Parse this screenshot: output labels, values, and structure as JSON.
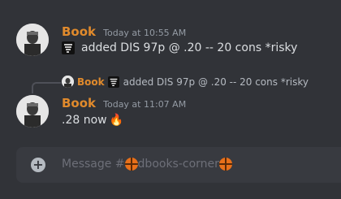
{
  "messages": [
    {
      "author": "Book",
      "timestamp": "Today at 10:55 AM",
      "content": "added DIS 97p @ .20 -- 20 cons  *risky",
      "icon": "tornado-icon"
    },
    {
      "reply_to": {
        "author": "Book",
        "content": "added DIS 97p @ .20 -- 20 cons *risky"
      },
      "author": "Book",
      "timestamp": "Today at 11:07 AM",
      "content": ".28 now",
      "emoji": "🔥"
    }
  ],
  "composer": {
    "placeholder_prefix": "Message #",
    "placeholder_channel": "dbooks-corner"
  },
  "colors": {
    "background": "#313338",
    "author": "#e08a2c",
    "input_bg": "#383a40"
  }
}
